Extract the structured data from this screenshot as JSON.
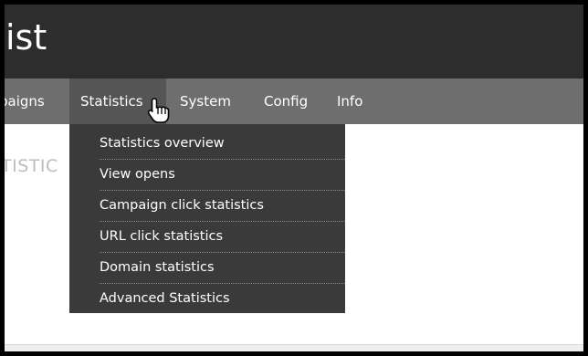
{
  "app": {
    "title": "ist"
  },
  "nav": {
    "items": [
      {
        "label": "paigns"
      },
      {
        "label": "Statistics"
      },
      {
        "label": "System"
      },
      {
        "label": "Config"
      },
      {
        "label": "Info"
      }
    ]
  },
  "page": {
    "heading": "TISTIC"
  },
  "dropdown": {
    "items": [
      {
        "label": "Statistics overview"
      },
      {
        "label": "View opens"
      },
      {
        "label": "Campaign click statistics"
      },
      {
        "label": "URL click statistics"
      },
      {
        "label": "Domain statistics"
      },
      {
        "label": "Advanced Statistics"
      }
    ]
  },
  "colors": {
    "header_bg": "#2d2d2d",
    "nav_bg": "#6e6e6e",
    "nav_active_bg": "#555555",
    "dropdown_bg": "#3a3a3a"
  },
  "icons": {
    "cursor": "hand-pointer-icon"
  }
}
